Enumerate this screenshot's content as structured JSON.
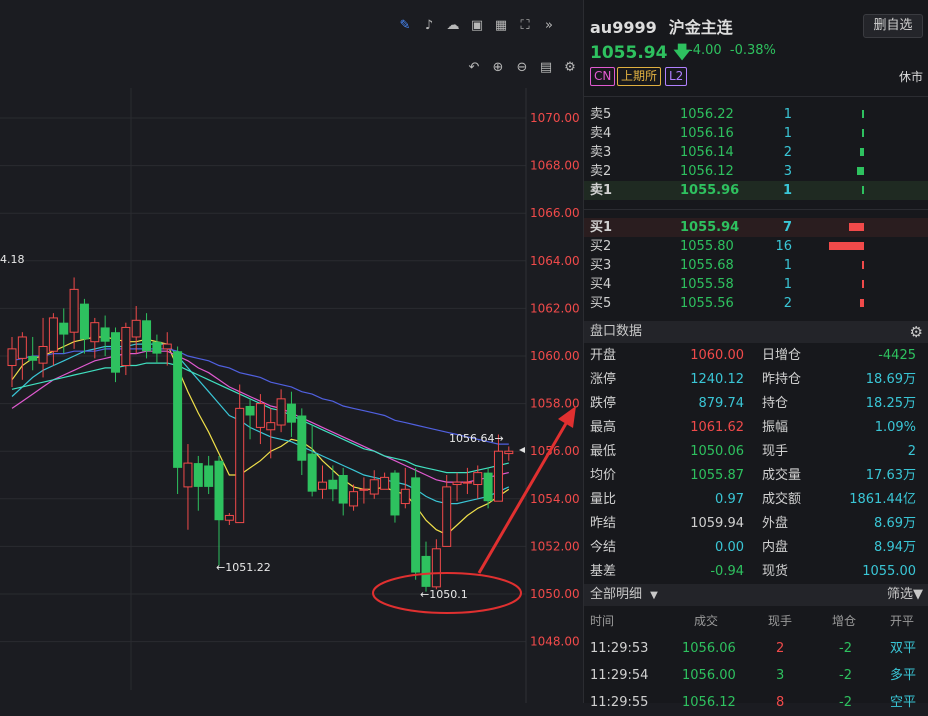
{
  "toolbar": {
    "top_icons": [
      "pencil-icon",
      "bell-icon",
      "cloud-icon",
      "camera-icon",
      "table-icon",
      "fullscreen-icon",
      "chevron-double-right-icon"
    ],
    "chart_icons": [
      "undo-icon",
      "zoom-in-icon",
      "zoom-out-icon",
      "layout-icon",
      "settings-icon"
    ]
  },
  "chart_data": {
    "type": "candlestick",
    "y_ticks": [
      "1070.00",
      "1068.00",
      "1066.00",
      "1064.00",
      "1062.00",
      "1060.00",
      "1058.00",
      "1056.00",
      "1054.00",
      "1052.00",
      "1050.00",
      "1048.00"
    ],
    "ylim": [
      1047,
      1072
    ],
    "up_color": "#f04a4a",
    "down_color": "#2ec15f",
    "candles": [
      [
        1059.6,
        1060.3,
        1058.7,
        1060.8
      ],
      [
        1059.9,
        1060.8,
        1059.0,
        1061.0
      ],
      [
        1060.0,
        1059.8,
        1059.4,
        1060.8
      ],
      [
        1059.7,
        1060.4,
        1059.1,
        1061.6
      ],
      [
        1060.2,
        1061.6,
        1059.6,
        1061.8
      ],
      [
        1061.4,
        1060.9,
        1060.1,
        1062.0
      ],
      [
        1061.0,
        1062.8,
        1060.3,
        1063.3
      ],
      [
        1062.2,
        1060.7,
        1060.1,
        1062.4
      ],
      [
        1060.6,
        1061.4,
        1059.9,
        1061.6
      ],
      [
        1061.2,
        1060.6,
        1060.0,
        1061.7
      ],
      [
        1061.0,
        1059.3,
        1058.9,
        1061.2
      ],
      [
        1059.6,
        1061.2,
        1059.2,
        1061.4
      ],
      [
        1060.8,
        1061.5,
        1060.1,
        1062.1
      ],
      [
        1061.5,
        1060.2,
        1059.9,
        1061.8
      ],
      [
        1060.6,
        1060.1,
        1059.7,
        1060.9
      ],
      [
        1060.3,
        1060.5,
        1059.6,
        1061.0
      ],
      [
        1060.2,
        1055.3,
        1054.2,
        1060.4
      ],
      [
        1054.5,
        1055.5,
        1052.7,
        1056.3
      ],
      [
        1055.5,
        1054.5,
        1053.5,
        1055.8
      ],
      [
        1055.4,
        1054.5,
        1054.2,
        1055.8
      ],
      [
        1055.6,
        1053.1,
        1051.2,
        1055.8
      ],
      [
        1053.1,
        1053.3,
        1052.9,
        1053.4
      ],
      [
        1053.0,
        1057.8,
        1053.0,
        1058.8
      ],
      [
        1057.9,
        1057.5,
        1056.5,
        1058.2
      ],
      [
        1057.0,
        1058.0,
        1056.3,
        1058.4
      ],
      [
        1056.9,
        1057.2,
        1055.7,
        1057.8
      ],
      [
        1057.1,
        1058.2,
        1056.8,
        1058.6
      ],
      [
        1058.0,
        1057.2,
        1056.6,
        1058.5
      ],
      [
        1057.5,
        1055.6,
        1055.0,
        1057.8
      ],
      [
        1055.9,
        1054.3,
        1054.1,
        1057.1
      ],
      [
        1054.4,
        1054.7,
        1054.0,
        1055.4
      ],
      [
        1054.8,
        1054.4,
        1053.9,
        1055.4
      ],
      [
        1055.0,
        1053.8,
        1053.3,
        1055.3
      ],
      [
        1053.7,
        1054.3,
        1053.5,
        1054.6
      ],
      [
        1054.4,
        1054.4,
        1053.8,
        1054.9
      ],
      [
        1054.2,
        1054.8,
        1054.0,
        1055.2
      ],
      [
        1054.4,
        1054.9,
        1054.4,
        1055.1
      ],
      [
        1055.1,
        1053.3,
        1053.0,
        1055.2
      ],
      [
        1053.8,
        1054.4,
        1053.6,
        1055.3
      ],
      [
        1054.9,
        1050.9,
        1050.6,
        1055.3
      ],
      [
        1051.6,
        1050.3,
        1050.1,
        1052.2
      ],
      [
        1050.3,
        1051.9,
        1050.2,
        1052.3
      ],
      [
        1052.0,
        1054.5,
        1052.0,
        1055.0
      ],
      [
        1054.6,
        1054.7,
        1053.9,
        1055.1
      ],
      [
        1054.7,
        1054.7,
        1054.2,
        1055.3
      ],
      [
        1054.6,
        1055.1,
        1054.0,
        1055.4
      ],
      [
        1055.1,
        1053.9,
        1053.6,
        1055.3
      ],
      [
        1053.9,
        1056.0,
        1053.9,
        1056.7
      ],
      [
        1055.9,
        1056.0,
        1055.6,
        1056.2
      ]
    ],
    "series": [
      {
        "color": "#f0e04a",
        "values": [
          1059.0,
          1059.6,
          1059.9,
          1060.0,
          1060.2,
          1060.4,
          1060.6,
          1060.7,
          1060.8,
          1060.8,
          1060.7,
          1060.6,
          1060.6,
          1060.7,
          1060.6,
          1060.5,
          1059.5,
          1058.5,
          1057.6,
          1056.8,
          1055.9,
          1055.0,
          1055.0,
          1055.3,
          1055.6,
          1056.0,
          1056.2,
          1056.5,
          1056.4,
          1056.1,
          1055.6,
          1055.2,
          1054.8,
          1054.5,
          1054.4,
          1054.4,
          1054.5,
          1054.3,
          1054.2,
          1053.7,
          1053.1,
          1052.7,
          1052.5,
          1052.9,
          1053.3,
          1053.6,
          1053.8,
          1054.1,
          1054.4
        ]
      },
      {
        "color": "#3ac6d6",
        "values": [
          1058.3,
          1058.7,
          1059.1,
          1059.4,
          1059.6,
          1059.8,
          1060.0,
          1060.2,
          1060.3,
          1060.4,
          1060.4,
          1060.4,
          1060.5,
          1060.5,
          1060.5,
          1060.5,
          1060.0,
          1059.5,
          1059.0,
          1058.5,
          1058.0,
          1057.5,
          1057.3,
          1057.0,
          1056.8,
          1056.6,
          1056.5,
          1056.4,
          1056.2,
          1056.0,
          1055.8,
          1055.6,
          1055.4,
          1055.2,
          1055.0,
          1054.9,
          1054.8,
          1054.7,
          1054.6,
          1054.4,
          1054.1,
          1053.9,
          1053.8,
          1053.8,
          1053.9,
          1054.0,
          1054.1,
          1054.3,
          1054.5
        ]
      },
      {
        "color": "#e05ad0",
        "values": [
          1057.8,
          1058.1,
          1058.4,
          1058.7,
          1059.0,
          1059.2,
          1059.4,
          1059.6,
          1059.8,
          1059.9,
          1060.0,
          1060.1,
          1060.1,
          1060.2,
          1060.2,
          1060.2,
          1060.0,
          1059.8,
          1059.5,
          1059.3,
          1059.0,
          1058.7,
          1058.5,
          1058.3,
          1058.1,
          1057.9,
          1057.8,
          1057.6,
          1057.4,
          1057.2,
          1057.0,
          1056.8,
          1056.6,
          1056.4,
          1056.2,
          1056.0,
          1055.8,
          1055.6,
          1055.4,
          1055.2,
          1055.0,
          1054.8,
          1054.7,
          1054.7,
          1054.7,
          1054.8,
          1054.9,
          1055.0,
          1055.1
        ]
      },
      {
        "color": "#40e0c0",
        "values": [
          1058.6,
          1058.7,
          1058.8,
          1058.9,
          1059.0,
          1059.1,
          1059.2,
          1059.3,
          1059.4,
          1059.5,
          1059.5,
          1059.6,
          1059.6,
          1059.7,
          1059.7,
          1059.7,
          1059.6,
          1059.4,
          1059.2,
          1059.0,
          1058.8,
          1058.6,
          1058.4,
          1058.2,
          1058.0,
          1057.8,
          1057.7,
          1057.5,
          1057.3,
          1057.1,
          1056.9,
          1056.7,
          1056.5,
          1056.3,
          1056.1,
          1056.0,
          1055.8,
          1055.7,
          1055.6,
          1055.4,
          1055.3,
          1055.2,
          1055.1,
          1055.1,
          1055.1,
          1055.2,
          1055.3,
          1055.4,
          1055.5
        ]
      },
      {
        "color": "#5060e0",
        "values": [
          1059.8,
          1059.9,
          1060.0,
          1060.0,
          1060.1,
          1060.1,
          1060.2,
          1060.2,
          1060.2,
          1060.3,
          1060.3,
          1060.3,
          1060.3,
          1060.3,
          1060.3,
          1060.3,
          1060.2,
          1060.0,
          1059.9,
          1059.8,
          1059.6,
          1059.5,
          1059.3,
          1059.2,
          1059.1,
          1058.9,
          1058.8,
          1058.7,
          1058.5,
          1058.4,
          1058.2,
          1058.1,
          1057.9,
          1057.8,
          1057.7,
          1057.6,
          1057.5,
          1057.3,
          1057.2,
          1057.1,
          1057.0,
          1056.9,
          1056.8,
          1056.7,
          1056.6,
          1056.5,
          1056.4,
          1056.3,
          1056.3
        ]
      }
    ],
    "annotations": {
      "left_label": "4.18",
      "low1": "1051.22",
      "low2": "1050.1",
      "high": "1056.64"
    }
  },
  "quote": {
    "symbol": "au9999",
    "name": "沪金主连",
    "delete_button": "删自选",
    "price": "1055.94",
    "change": "-4.00",
    "change_pct": "-0.38%",
    "tags": [
      {
        "text": "CN",
        "color": "#e05ad0"
      },
      {
        "text": "上期所",
        "color": "#e0b040"
      },
      {
        "text": "L2",
        "color": "#b080ff"
      }
    ],
    "status": "休市"
  },
  "orderbook": {
    "asks": [
      {
        "label": "卖5",
        "price": "1056.22",
        "volume": "1",
        "bar": 1
      },
      {
        "label": "卖4",
        "price": "1056.16",
        "volume": "1",
        "bar": 1
      },
      {
        "label": "卖3",
        "price": "1056.14",
        "volume": "2",
        "bar": 2
      },
      {
        "label": "卖2",
        "price": "1056.12",
        "volume": "3",
        "bar": 3
      },
      {
        "label": "卖1",
        "price": "1055.96",
        "volume": "1",
        "bar": 1
      }
    ],
    "bids": [
      {
        "label": "买1",
        "price": "1055.94",
        "volume": "7",
        "bar": 7
      },
      {
        "label": "买2",
        "price": "1055.80",
        "volume": "16",
        "bar": 16
      },
      {
        "label": "买3",
        "price": "1055.68",
        "volume": "1",
        "bar": 1
      },
      {
        "label": "买4",
        "price": "1055.58",
        "volume": "1",
        "bar": 1
      },
      {
        "label": "买5",
        "price": "1055.56",
        "volume": "2",
        "bar": 2
      }
    ]
  },
  "stats": {
    "title": "盘口数据",
    "rows": [
      {
        "k1": "开盘",
        "v1": "1060.00",
        "c1": "#f04a4a",
        "k2": "日增仓",
        "v2": "-4425",
        "c2": "#2ec15f"
      },
      {
        "k1": "涨停",
        "v1": "1240.12",
        "c1": "#3ac6d6",
        "k2": "昨持仓",
        "v2": "18.69万",
        "c2": "#3ac6d6"
      },
      {
        "k1": "跌停",
        "v1": "879.74",
        "c1": "#3ac6d6",
        "k2": "持仓",
        "v2": "18.25万",
        "c2": "#3ac6d6"
      },
      {
        "k1": "最高",
        "v1": "1061.62",
        "c1": "#f04a4a",
        "k2": "振幅",
        "v2": "1.09%",
        "c2": "#3ac6d6"
      },
      {
        "k1": "最低",
        "v1": "1050.06",
        "c1": "#2ec15f",
        "k2": "现手",
        "v2": "2",
        "c2": "#3ac6d6"
      },
      {
        "k1": "均价",
        "v1": "1055.87",
        "c1": "#2ec15f",
        "k2": "成交量",
        "v2": "17.63万",
        "c2": "#3ac6d6"
      },
      {
        "k1": "量比",
        "v1": "0.97",
        "c1": "#3ac6d6",
        "k2": "成交额",
        "v2": "1861.44亿",
        "c2": "#3ac6d6"
      },
      {
        "k1": "昨结",
        "v1": "1059.94",
        "c1": "#d0d0d0",
        "k2": "外盘",
        "v2": "8.69万",
        "c2": "#3ac6d6"
      },
      {
        "k1": "今结",
        "v1": "0.00",
        "c1": "#3ac6d6",
        "k2": "内盘",
        "v2": "8.94万",
        "c2": "#3ac6d6"
      },
      {
        "k1": "基差",
        "v1": "-0.94",
        "c1": "#2ec15f",
        "k2": "现货",
        "v2": "1055.00",
        "c2": "#3ac6d6"
      }
    ]
  },
  "trades": {
    "title": "全部明细",
    "filter": "筛选",
    "headers": [
      "时间",
      "成交",
      "现手",
      "增仓",
      "开平"
    ],
    "rows": [
      {
        "time": "11:29:53",
        "price": "1056.06",
        "vol": "2",
        "vol_color": "#f04a4a",
        "oi": "-2",
        "type": "双平"
      },
      {
        "time": "11:29:54",
        "price": "1056.00",
        "vol": "3",
        "vol_color": "#2ec15f",
        "oi": "-2",
        "type": "多平"
      },
      {
        "time": "11:29:55",
        "price": "1056.12",
        "vol": "8",
        "vol_color": "#f04a4a",
        "oi": "-2",
        "type": "空平"
      }
    ]
  }
}
